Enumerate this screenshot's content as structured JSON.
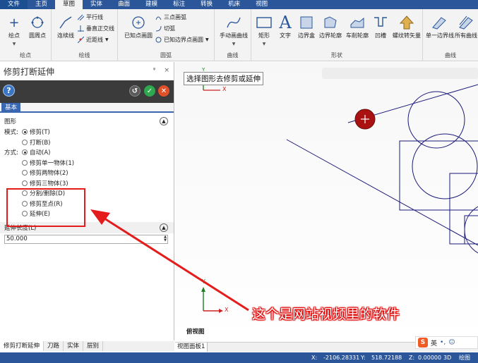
{
  "menubar": {
    "items": [
      "文件",
      "主页",
      "草图",
      "实体",
      "曲面",
      "建模",
      "标注",
      "转换",
      "机床",
      "视图"
    ],
    "active_index": 2
  },
  "ribbon": {
    "groups": [
      {
        "label": "绘点",
        "big": [
          "绘点",
          "圆周点"
        ]
      },
      {
        "label": "绘线",
        "big": [
          "连续线"
        ],
        "small": [
          "平行线",
          "垂直正交线",
          "近距线"
        ]
      },
      {
        "label": "圆弧",
        "big": [
          "已知点画圆"
        ],
        "small": [
          "三点画弧",
          "切弧",
          "已知边界点画圆"
        ]
      },
      {
        "label": "曲线",
        "big": [
          "手动画曲线"
        ]
      },
      {
        "label": "形状",
        "big": [
          "矩形",
          "文字",
          "边界盒",
          "边界轮廓",
          "车削轮廓",
          "凹槽",
          "螺纹转矢量"
        ]
      },
      {
        "label": "曲线",
        "big": [
          "单一边界线",
          "所有曲线"
        ]
      }
    ]
  },
  "panel": {
    "title": "修剪打断延伸",
    "pin": "ᵠ",
    "close": "×",
    "tab_basic": "基本",
    "section_shape": "图形",
    "mode_label": "模式:",
    "mode_options": [
      "修剪(T)",
      "打断(B)"
    ],
    "method_label": "方式:",
    "method_options": [
      "自动(A)",
      "修剪单一物体(1)",
      "修剪两物体(2)",
      "修剪三物体(3)",
      "分割/删除(D)",
      "修剪至点(R)",
      "延伸(E)"
    ],
    "length_label": "延伸长度(L)",
    "length_value": "50.000",
    "bottom_tabs": [
      "修剪打断延伸",
      "刀路",
      "实体",
      "层别"
    ]
  },
  "viewport": {
    "prompt": "选择图形去修剪或延伸",
    "view_name": "俯视图",
    "view_tab": "视图面板1",
    "axis_x": "X",
    "axis_y": "Y"
  },
  "ime": {
    "logo": "S",
    "lang": "英"
  },
  "status": {
    "x_label": "X:",
    "x_value": "-2106.28331",
    "y_label": "Y:",
    "y_value": "518.72188",
    "z_label": "Z:",
    "z_value": "0.00000",
    "mode": "3D",
    "tail": "绘图"
  },
  "annotation": {
    "text": "这个是网站视频里的软件"
  },
  "colors": {
    "menubar": "#2b579a",
    "annotation": "#e41c1c",
    "geometry": "#1a1a7a",
    "axis": "#1e7d1e"
  }
}
